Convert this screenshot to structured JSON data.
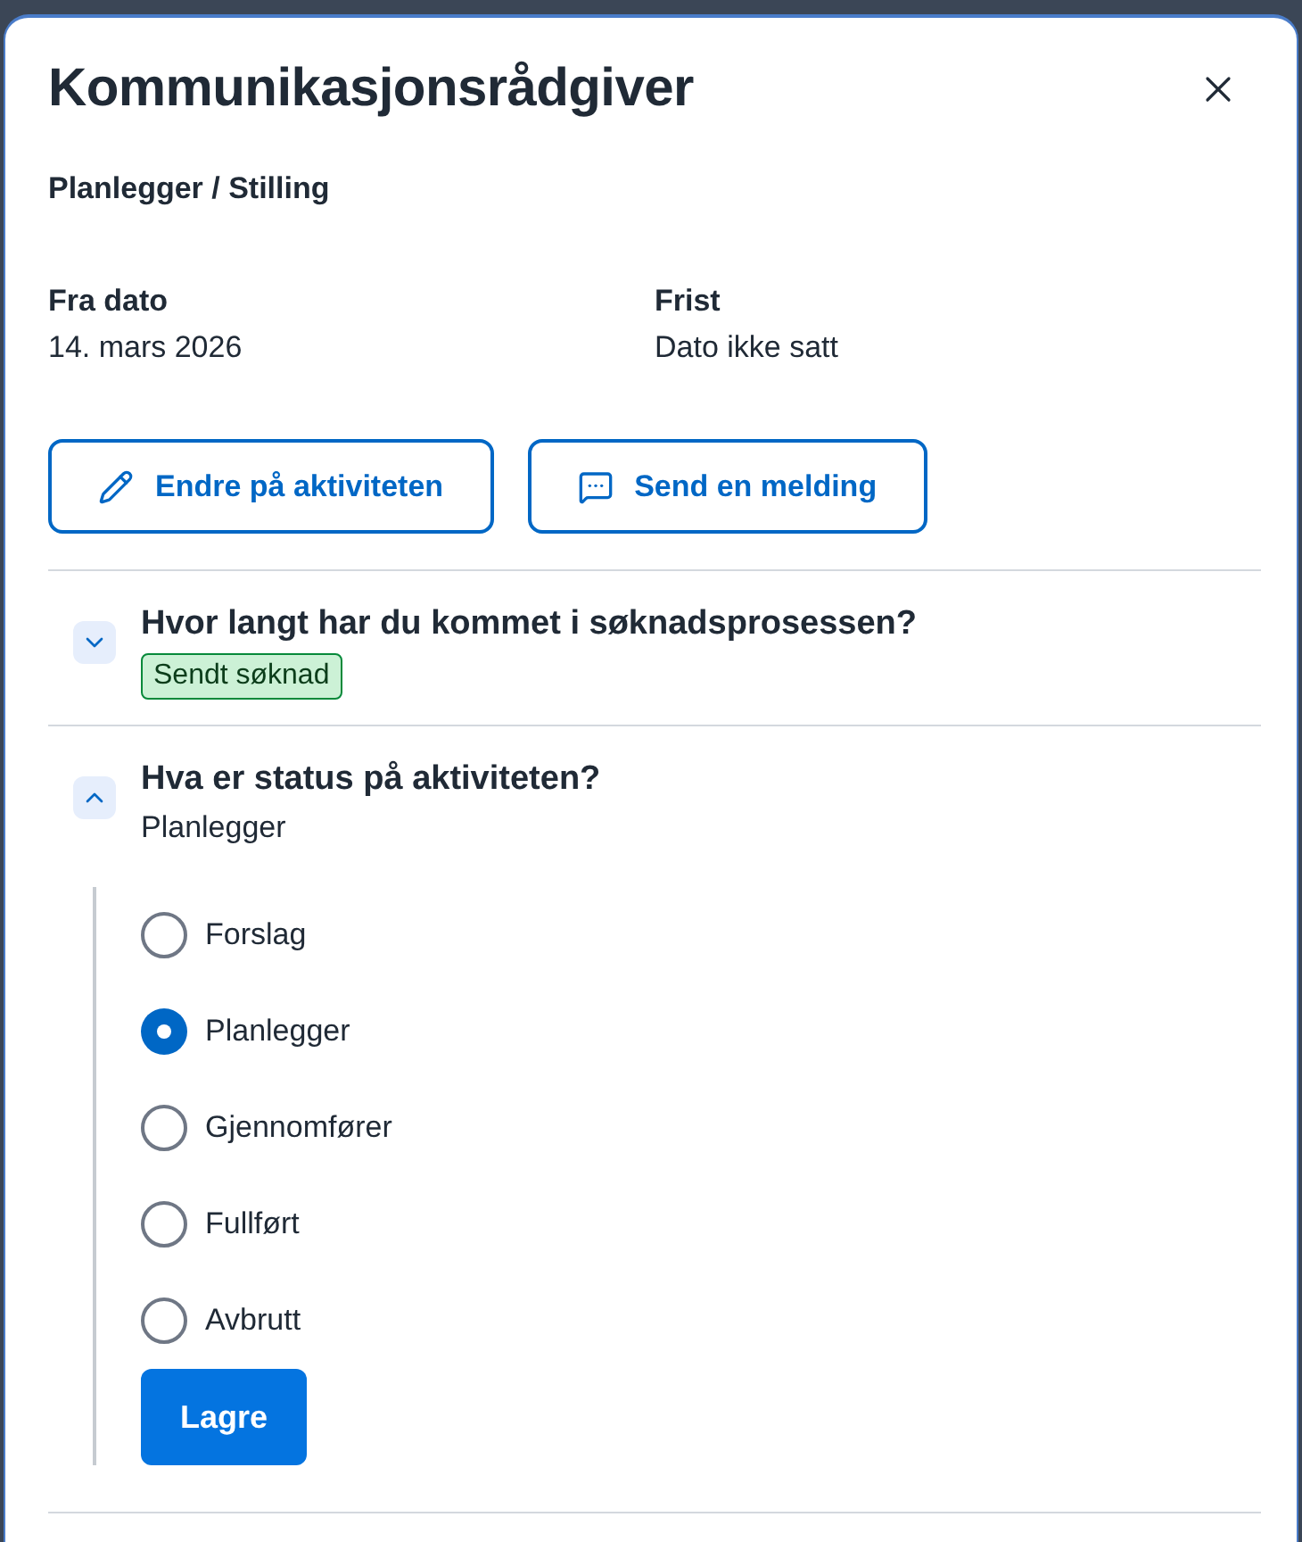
{
  "dialog": {
    "title": "Kommunikasjonsrådgiver",
    "subtitle": "Planlegger / Stilling"
  },
  "details": [
    {
      "label": "Fra dato",
      "value": "14. mars 2026"
    },
    {
      "label": "Frist",
      "value": "Dato ikke satt"
    }
  ],
  "actions": [
    {
      "kind": "edit",
      "label": "Endre på aktiviteten"
    },
    {
      "kind": "message",
      "label": "Send en melding"
    }
  ],
  "accordion": [
    {
      "title": "Hvor langt har du kommet i søknadsprosessen?",
      "expanded": false,
      "tag": "Sendt søknad"
    },
    {
      "title": "Hva er status på aktiviteten?",
      "expanded": true,
      "summary": "Planlegger",
      "options": [
        {
          "label": "Forslag",
          "selected": false
        },
        {
          "label": "Planlegger",
          "selected": true
        },
        {
          "label": "Gjennomfører",
          "selected": false
        },
        {
          "label": "Fullført",
          "selected": false
        },
        {
          "label": "Avbrutt",
          "selected": false
        }
      ],
      "submit": "Lagre"
    }
  ]
}
